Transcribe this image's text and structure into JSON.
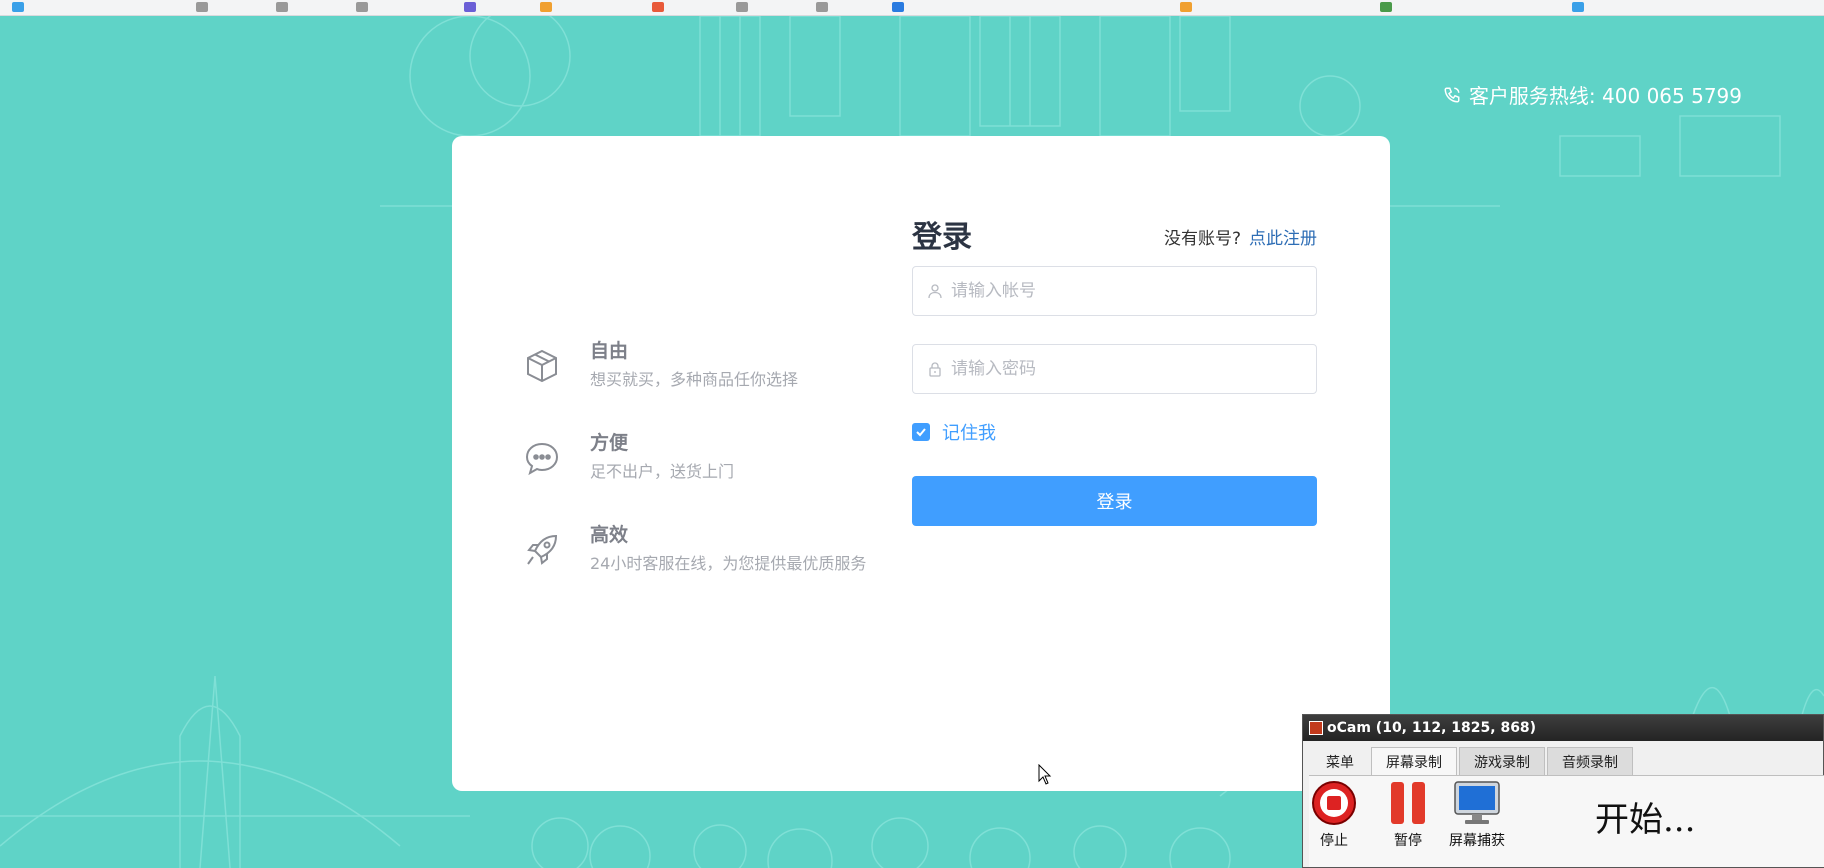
{
  "hotline": {
    "text": "客户服务热线: 400 065 5799"
  },
  "features": [
    {
      "icon": "box-icon",
      "title": "自由",
      "desc": "想买就买，多种商品任你选择"
    },
    {
      "icon": "chat-icon",
      "title": "方便",
      "desc": "足不出户，送货上门"
    },
    {
      "icon": "rocket-icon",
      "title": "高效",
      "desc": "24小时客服在线，为您提供最优质服务"
    }
  ],
  "login": {
    "title": "登录",
    "no_account": "没有账号?",
    "register_link": "点此注册",
    "account_placeholder": "请输入帐号",
    "password_placeholder": "请输入密码",
    "remember_label": "记住我",
    "remember_checked": true,
    "submit_label": "登录"
  },
  "ocam": {
    "title": "oCam (10, 112, 1825, 868)",
    "tabs": [
      "菜单",
      "屏幕录制",
      "游戏录制",
      "音频录制"
    ],
    "active_tab": "屏幕录制",
    "tools": {
      "stop": "停止",
      "pause": "暂停",
      "capture": "屏幕捕获"
    },
    "status": "开始..."
  },
  "colors": {
    "background": "#5fd3c7",
    "primary": "#409eff",
    "link": "#2d6db5"
  }
}
